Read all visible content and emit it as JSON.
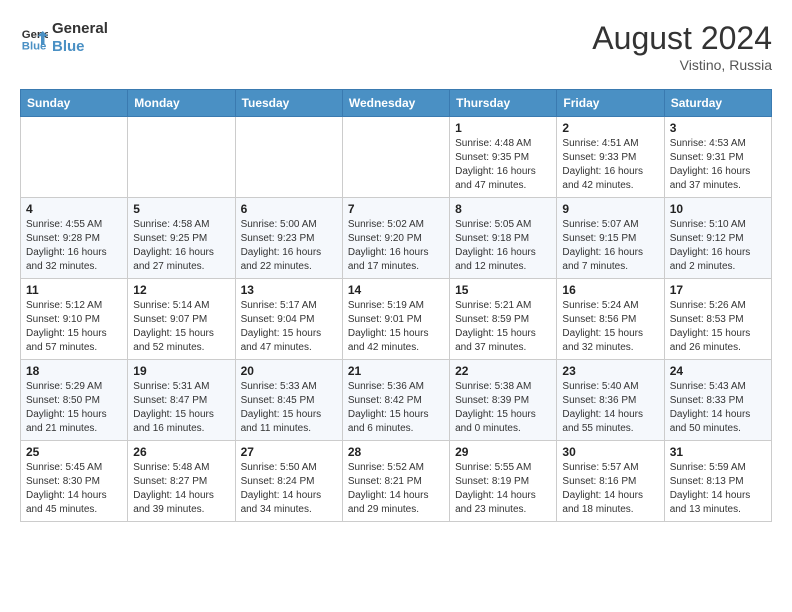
{
  "header": {
    "logo_line1": "General",
    "logo_line2": "Blue",
    "month_year": "August 2024",
    "location": "Vistino, Russia"
  },
  "weekdays": [
    "Sunday",
    "Monday",
    "Tuesday",
    "Wednesday",
    "Thursday",
    "Friday",
    "Saturday"
  ],
  "weeks": [
    [
      {
        "day": "",
        "info": ""
      },
      {
        "day": "",
        "info": ""
      },
      {
        "day": "",
        "info": ""
      },
      {
        "day": "",
        "info": ""
      },
      {
        "day": "1",
        "info": "Sunrise: 4:48 AM\nSunset: 9:35 PM\nDaylight: 16 hours\nand 47 minutes."
      },
      {
        "day": "2",
        "info": "Sunrise: 4:51 AM\nSunset: 9:33 PM\nDaylight: 16 hours\nand 42 minutes."
      },
      {
        "day": "3",
        "info": "Sunrise: 4:53 AM\nSunset: 9:31 PM\nDaylight: 16 hours\nand 37 minutes."
      }
    ],
    [
      {
        "day": "4",
        "info": "Sunrise: 4:55 AM\nSunset: 9:28 PM\nDaylight: 16 hours\nand 32 minutes."
      },
      {
        "day": "5",
        "info": "Sunrise: 4:58 AM\nSunset: 9:25 PM\nDaylight: 16 hours\nand 27 minutes."
      },
      {
        "day": "6",
        "info": "Sunrise: 5:00 AM\nSunset: 9:23 PM\nDaylight: 16 hours\nand 22 minutes."
      },
      {
        "day": "7",
        "info": "Sunrise: 5:02 AM\nSunset: 9:20 PM\nDaylight: 16 hours\nand 17 minutes."
      },
      {
        "day": "8",
        "info": "Sunrise: 5:05 AM\nSunset: 9:18 PM\nDaylight: 16 hours\nand 12 minutes."
      },
      {
        "day": "9",
        "info": "Sunrise: 5:07 AM\nSunset: 9:15 PM\nDaylight: 16 hours\nand 7 minutes."
      },
      {
        "day": "10",
        "info": "Sunrise: 5:10 AM\nSunset: 9:12 PM\nDaylight: 16 hours\nand 2 minutes."
      }
    ],
    [
      {
        "day": "11",
        "info": "Sunrise: 5:12 AM\nSunset: 9:10 PM\nDaylight: 15 hours\nand 57 minutes."
      },
      {
        "day": "12",
        "info": "Sunrise: 5:14 AM\nSunset: 9:07 PM\nDaylight: 15 hours\nand 52 minutes."
      },
      {
        "day": "13",
        "info": "Sunrise: 5:17 AM\nSunset: 9:04 PM\nDaylight: 15 hours\nand 47 minutes."
      },
      {
        "day": "14",
        "info": "Sunrise: 5:19 AM\nSunset: 9:01 PM\nDaylight: 15 hours\nand 42 minutes."
      },
      {
        "day": "15",
        "info": "Sunrise: 5:21 AM\nSunset: 8:59 PM\nDaylight: 15 hours\nand 37 minutes."
      },
      {
        "day": "16",
        "info": "Sunrise: 5:24 AM\nSunset: 8:56 PM\nDaylight: 15 hours\nand 32 minutes."
      },
      {
        "day": "17",
        "info": "Sunrise: 5:26 AM\nSunset: 8:53 PM\nDaylight: 15 hours\nand 26 minutes."
      }
    ],
    [
      {
        "day": "18",
        "info": "Sunrise: 5:29 AM\nSunset: 8:50 PM\nDaylight: 15 hours\nand 21 minutes."
      },
      {
        "day": "19",
        "info": "Sunrise: 5:31 AM\nSunset: 8:47 PM\nDaylight: 15 hours\nand 16 minutes."
      },
      {
        "day": "20",
        "info": "Sunrise: 5:33 AM\nSunset: 8:45 PM\nDaylight: 15 hours\nand 11 minutes."
      },
      {
        "day": "21",
        "info": "Sunrise: 5:36 AM\nSunset: 8:42 PM\nDaylight: 15 hours\nand 6 minutes."
      },
      {
        "day": "22",
        "info": "Sunrise: 5:38 AM\nSunset: 8:39 PM\nDaylight: 15 hours\nand 0 minutes."
      },
      {
        "day": "23",
        "info": "Sunrise: 5:40 AM\nSunset: 8:36 PM\nDaylight: 14 hours\nand 55 minutes."
      },
      {
        "day": "24",
        "info": "Sunrise: 5:43 AM\nSunset: 8:33 PM\nDaylight: 14 hours\nand 50 minutes."
      }
    ],
    [
      {
        "day": "25",
        "info": "Sunrise: 5:45 AM\nSunset: 8:30 PM\nDaylight: 14 hours\nand 45 minutes."
      },
      {
        "day": "26",
        "info": "Sunrise: 5:48 AM\nSunset: 8:27 PM\nDaylight: 14 hours\nand 39 minutes."
      },
      {
        "day": "27",
        "info": "Sunrise: 5:50 AM\nSunset: 8:24 PM\nDaylight: 14 hours\nand 34 minutes."
      },
      {
        "day": "28",
        "info": "Sunrise: 5:52 AM\nSunset: 8:21 PM\nDaylight: 14 hours\nand 29 minutes."
      },
      {
        "day": "29",
        "info": "Sunrise: 5:55 AM\nSunset: 8:19 PM\nDaylight: 14 hours\nand 23 minutes."
      },
      {
        "day": "30",
        "info": "Sunrise: 5:57 AM\nSunset: 8:16 PM\nDaylight: 14 hours\nand 18 minutes."
      },
      {
        "day": "31",
        "info": "Sunrise: 5:59 AM\nSunset: 8:13 PM\nDaylight: 14 hours\nand 13 minutes."
      }
    ]
  ]
}
